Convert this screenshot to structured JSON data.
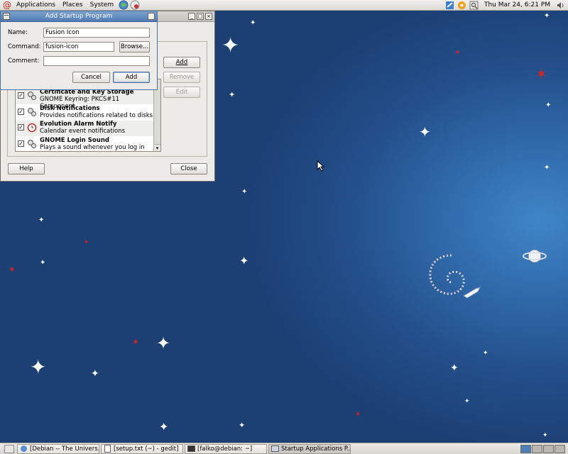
{
  "top_panel": {
    "menus": [
      "Applications",
      "Places",
      "System"
    ],
    "clock": "Thu Mar 24,  6:21 PM"
  },
  "startup_window": {
    "buttons": {
      "add": "Add",
      "remove": "Remove",
      "edit": "Edit",
      "help": "Help",
      "close": "Close"
    },
    "items": [
      {
        "title": "Certificate and Key Storage",
        "desc": "GNOME Keyring: PKCS#11 Component",
        "checked": true
      },
      {
        "title": "Disk Notifications",
        "desc": "Provides notifications related to disks",
        "checked": true
      },
      {
        "title": "Evolution Alarm Notify",
        "desc": "Calendar event notifications",
        "checked": true
      },
      {
        "title": "GNOME Login Sound",
        "desc": "Plays a sound whenever you log in",
        "checked": true
      }
    ]
  },
  "add_dialog": {
    "title": "Add Startup Program",
    "name_label": "Name:",
    "name_value": "Fusion Icon",
    "command_label": "Command:",
    "command_value": "fusion-icon",
    "browse_label": "Browse...",
    "comment_label": "Comment:",
    "comment_value": "",
    "cancel_label": "Cancel",
    "add_label": "Add"
  },
  "taskbar": {
    "tasks": [
      {
        "label": "[Debian -- The Univers...",
        "active": false
      },
      {
        "label": "[setup.txt (~) - gedit]",
        "active": false
      },
      {
        "label": "[falko@debian: ~]",
        "active": false
      },
      {
        "label": "Startup Applications P...",
        "active": true
      }
    ]
  }
}
